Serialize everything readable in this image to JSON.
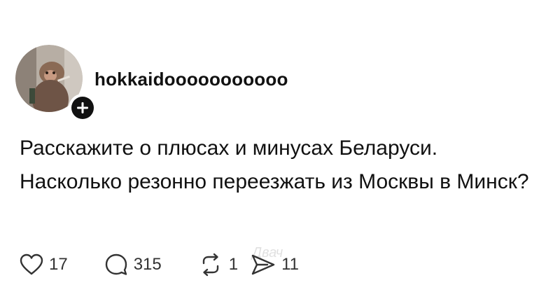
{
  "post": {
    "author": {
      "username": "hokkaidooooooooooo",
      "avatar_icon": "monkey-avatar-photo",
      "follow_icon": "plus-icon"
    },
    "text": "Расскажите о плюсах и минусах Беларуси. Насколько резонно переезжать из Москвы в Минск?",
    "actions": {
      "like": {
        "icon": "heart-icon",
        "count": "17"
      },
      "reply": {
        "icon": "comment-icon",
        "count": "315"
      },
      "repost": {
        "icon": "repost-icon",
        "count": "1"
      },
      "share": {
        "icon": "send-icon",
        "count": "11"
      }
    },
    "watermark": "Двач"
  }
}
